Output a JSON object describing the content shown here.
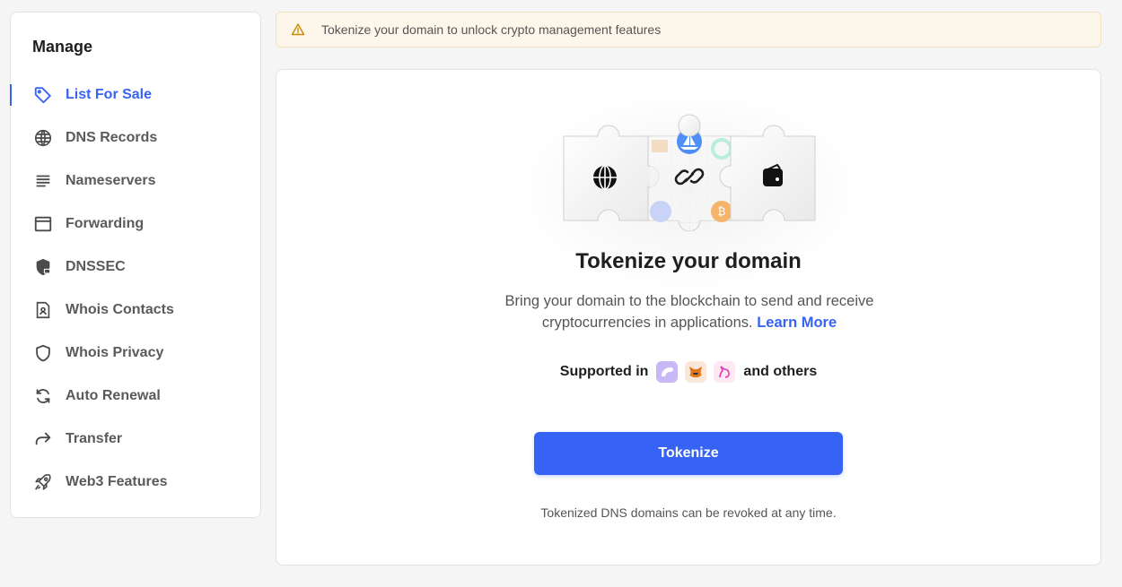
{
  "sidebar": {
    "title": "Manage",
    "items": [
      {
        "label": "List For Sale",
        "icon": "tag-icon",
        "active": true
      },
      {
        "label": "DNS Records",
        "icon": "globe-icon"
      },
      {
        "label": "Nameservers",
        "icon": "lines-icon"
      },
      {
        "label": "Forwarding",
        "icon": "window-icon"
      },
      {
        "label": "DNSSEC",
        "icon": "shield-lock-icon"
      },
      {
        "label": "Whois Contacts",
        "icon": "contact-file-icon"
      },
      {
        "label": "Whois Privacy",
        "icon": "shield-icon"
      },
      {
        "label": "Auto Renewal",
        "icon": "refresh-icon"
      },
      {
        "label": "Transfer",
        "icon": "forward-arrow-icon"
      },
      {
        "label": "Web3 Features",
        "icon": "rocket-icon"
      }
    ]
  },
  "banner": {
    "icon": "warning-icon",
    "text": "Tokenize your domain to unlock crypto management features"
  },
  "main": {
    "title": "Tokenize your domain",
    "description": "Bring your domain to the blockchain to send and receive cryptocurrencies in applications.",
    "learn_more": "Learn More",
    "supported_prefix": "Supported in",
    "supported_suffix": "and others",
    "supported_logos": [
      "wallet-app-icon",
      "metamask-fox-icon",
      "uniswap-unicorn-icon"
    ],
    "button_label": "Tokenize",
    "footnote": "Tokenized DNS domains can be revoked at any time."
  },
  "colors": {
    "accent": "#3763f4",
    "banner_bg": "#fdf6ea",
    "warning": "#c98a00"
  }
}
